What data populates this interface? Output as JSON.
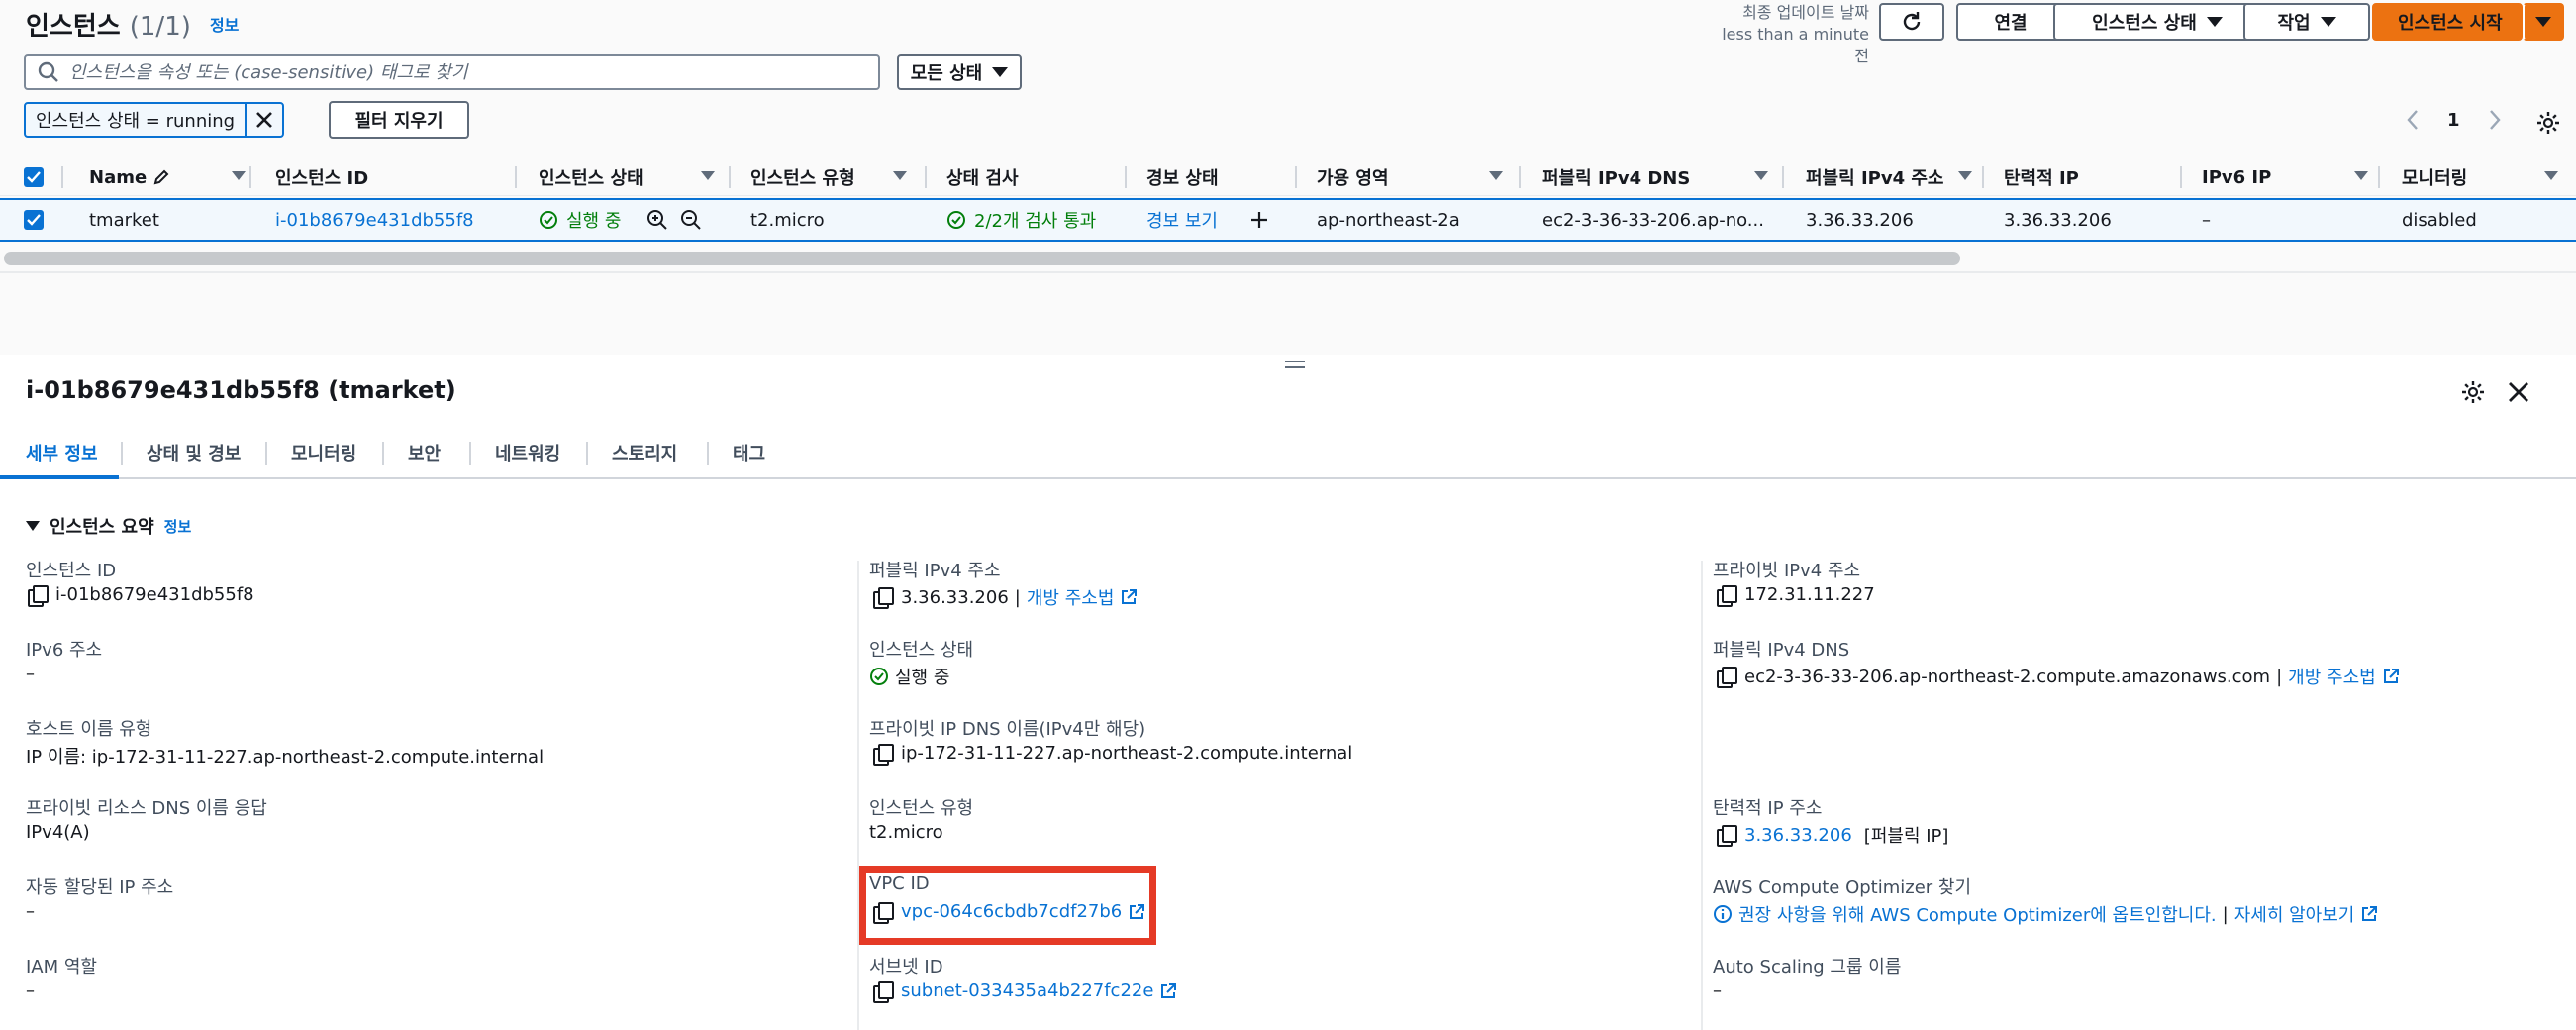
{
  "header": {
    "title": "인스턴스",
    "count": "(1/1)",
    "info": "정보",
    "updated_label": "최종 업데이트 날짜",
    "updated_value": "less than a minute 전",
    "connect": "연결",
    "instance_state": "인스턴스 상태",
    "actions": "작업",
    "launch": "인스턴스 시작"
  },
  "search": {
    "placeholder": "인스턴스을 속성 또는 (case-sensitive) 태그로 찾기",
    "state_filter": "모든 상태"
  },
  "filter": {
    "chip": "인스턴스 상태 = running",
    "clear": "필터 지우기"
  },
  "pager": {
    "page": "1"
  },
  "table": {
    "columns": [
      "Name",
      "인스턴스 ID",
      "인스턴스 상태",
      "인스턴스 유형",
      "상태 검사",
      "경보 상태",
      "가용 영역",
      "퍼블릭 IPv4 DNS",
      "퍼블릭 IPv4 주소",
      "탄력적 IP",
      "IPv6 IP",
      "모니터링"
    ],
    "row": {
      "name": "tmarket",
      "id": "i-01b8679e431db55f8",
      "state": "실행 중",
      "type": "t2.micro",
      "check": "2/2개 검사 통과",
      "alarm": "경보 보기",
      "az": "ap-northeast-2a",
      "dns": "ec2-3-36-33-206.ap-no...",
      "ipv4": "3.36.33.206",
      "eip": "3.36.33.206",
      "ipv6": "–",
      "monitoring": "disabled"
    }
  },
  "panel": {
    "title": "i-01b8679e431db55f8 (tmarket)",
    "tabs": [
      "세부 정보",
      "상태 및 경보",
      "모니터링",
      "보안",
      "네트워킹",
      "스토리지",
      "태그"
    ],
    "section": "인스턴스 요약",
    "section_info": "정보",
    "col1": [
      {
        "label": "인스턴스 ID",
        "value": "i-01b8679e431db55f8"
      },
      {
        "label": "IPv6 주소",
        "value": "–"
      },
      {
        "label": "호스트 이름 유형",
        "value": "IP 이름: ip-172-31-11-227.ap-northeast-2.compute.internal"
      },
      {
        "label": "프라이빗 리소스 DNS 이름 응답",
        "value": "IPv4(A)"
      },
      {
        "label": "자동 할당된 IP 주소",
        "value": "–"
      },
      {
        "label": "IAM 역할",
        "value": "–"
      }
    ],
    "col2": [
      {
        "label": "퍼블릭 IPv4 주소",
        "value": "3.36.33.206",
        "link": "개방 주소법"
      },
      {
        "label": "인스턴스 상태",
        "value": "실행 중"
      },
      {
        "label": "프라이빗 IP DNS 이름(IPv4만 해당)",
        "value": "ip-172-31-11-227.ap-northeast-2.compute.internal"
      },
      {
        "label": "인스턴스 유형",
        "value": "t2.micro"
      },
      {
        "label": "VPC ID",
        "value": "vpc-064c6cbdb7cdf27b6"
      },
      {
        "label": "서브넷 ID",
        "value": "subnet-033435a4b227fc22e"
      }
    ],
    "col3": [
      {
        "label": "프라이빗 IPv4 주소",
        "value": "172.31.11.227"
      },
      {
        "label": "퍼블릭 IPv4 DNS",
        "value": "ec2-3-36-33-206.ap-northeast-2.compute.amazonaws.com",
        "link": "개방 주소법"
      },
      {
        "label": "탄력적 IP 주소",
        "value": "3.36.33.206",
        "suffix": "[퍼블릭 IP]"
      },
      {
        "label": "AWS Compute Optimizer 찾기",
        "value": "권장 사항을 위해 AWS Compute Optimizer에 옵트인합니다.",
        "link": "자세히 알아보기"
      },
      {
        "label": "Auto Scaling 그룹 이름",
        "value": "–"
      }
    ]
  }
}
